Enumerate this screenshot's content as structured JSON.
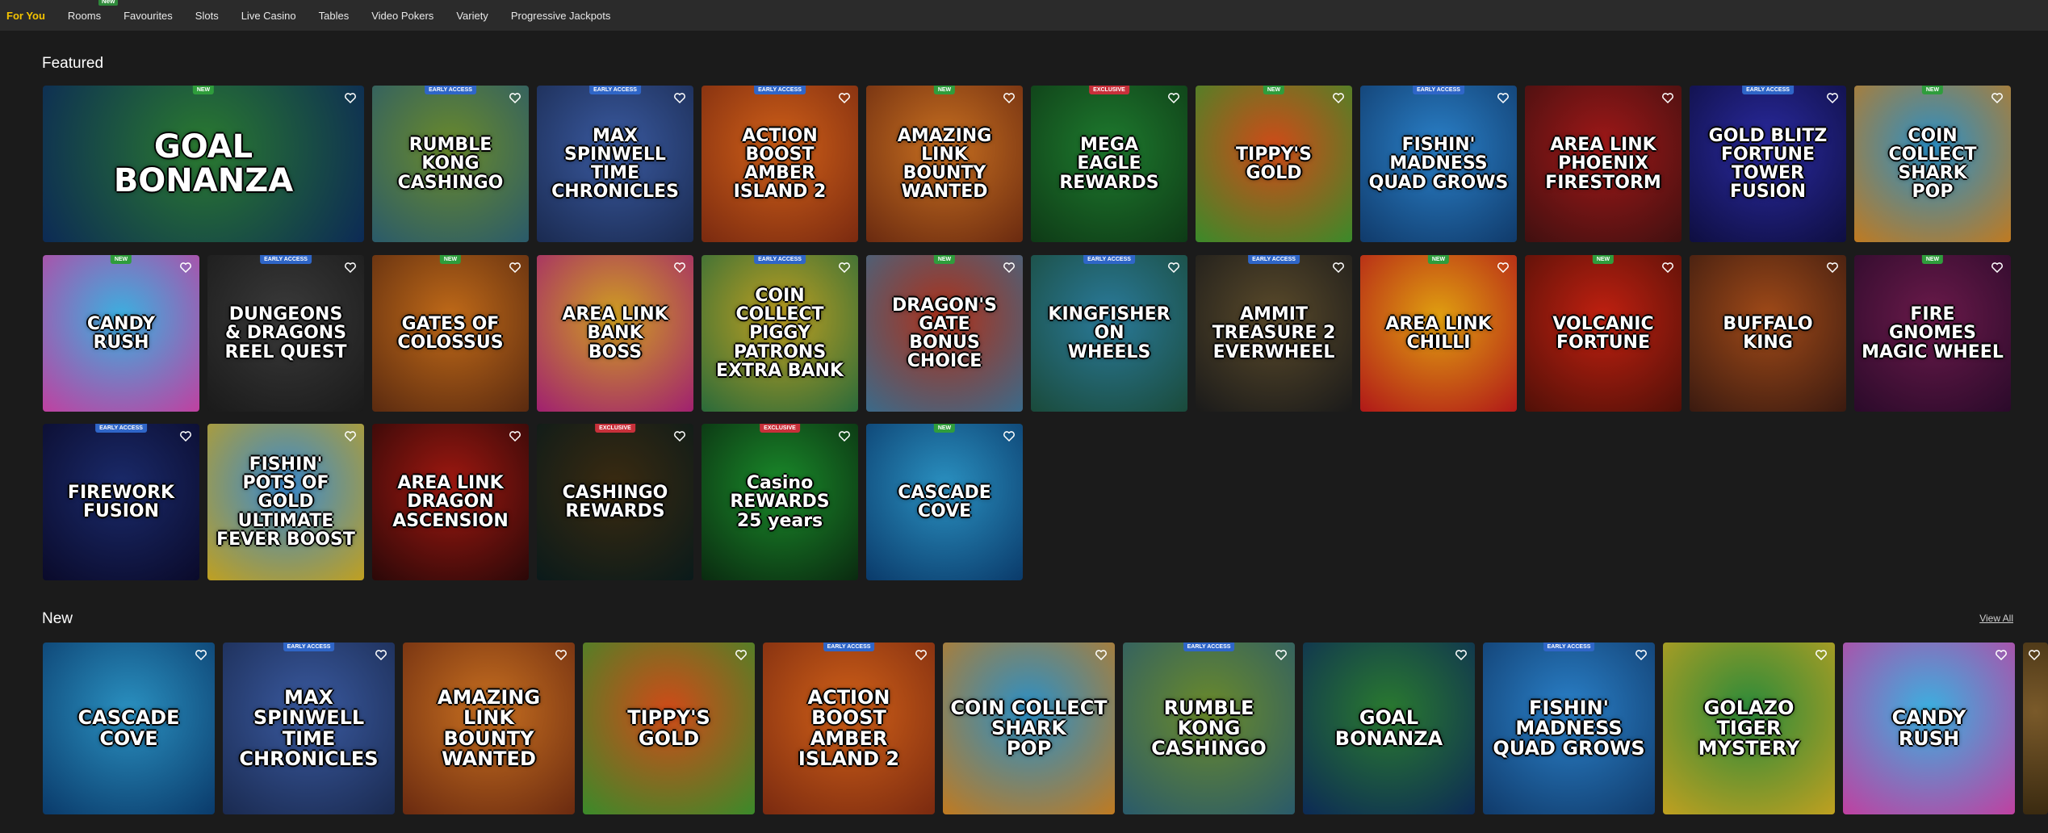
{
  "nav": {
    "items": [
      {
        "label": "For You",
        "active": true
      },
      {
        "label": "Rooms",
        "badge": "New"
      },
      {
        "label": "Favourites"
      },
      {
        "label": "Slots"
      },
      {
        "label": "Live Casino"
      },
      {
        "label": "Tables"
      },
      {
        "label": "Video Pokers"
      },
      {
        "label": "Variety"
      },
      {
        "label": "Progressive Jackpots"
      }
    ]
  },
  "featured": {
    "title": "Featured",
    "games": [
      {
        "title": "GOAL\nBONANZA",
        "badge": "NEW",
        "color": "#2a7a2f",
        "color2": "#0c2a55"
      },
      {
        "title": "RUMBLE\nKONG\nCASHINGO",
        "badge": "EARLY ACCESS",
        "color": "#6a8a2a",
        "color2": "#2a5a6a"
      },
      {
        "title": "MAX\nSPINWELL\nTIME CHRONICLES",
        "badge": "EARLY ACCESS",
        "color": "#3a5aa0",
        "color2": "#1a2a50"
      },
      {
        "title": "ACTION BOOST\nAMBER\nISLAND 2",
        "badge": "EARLY ACCESS",
        "color": "#d06018",
        "color2": "#7a2a10"
      },
      {
        "title": "AMAZING LINK\nBOUNTY\nWANTED",
        "badge": "NEW",
        "color": "#c87020",
        "color2": "#6a2a10"
      },
      {
        "title": "MEGA\nEAGLE\nREWARDS",
        "badge": "EXCLUSIVE",
        "color": "#1e7a2e",
        "color2": "#0e3a16"
      },
      {
        "title": "TIPPY'S\nGOLD",
        "badge": "NEW",
        "color": "#d04a18",
        "color2": "#3a8a2a"
      },
      {
        "title": "FISHIN'\nMADNESS\nQUAD GROWS",
        "badge": "EARLY ACCESS",
        "color": "#2a80c8",
        "color2": "#103a6a"
      },
      {
        "title": "AREA LINK\nPHOENIX\nFIRESTORM",
        "color": "#a01818",
        "color2": "#401010"
      },
      {
        "title": "GOLD BLITZ\nFORTUNE TOWER\nFUSION",
        "badge": "EARLY ACCESS",
        "color": "#2a2aa0",
        "color2": "#0e0e40"
      },
      {
        "title": "COIN COLLECT\nSHARK\nPOP",
        "badge": "NEW",
        "color": "#2a90c8",
        "color2": "#c07a20"
      },
      {
        "title": "CANDY\nRUSH",
        "badge": "NEW",
        "color": "#3ab0e0",
        "color2": "#c040a0"
      },
      {
        "title": "DUNGEONS\n& DRAGONS\nREEL QUEST",
        "badge": "EARLY ACCESS",
        "color": "#3a3a3a",
        "color2": "#1a1a1a"
      },
      {
        "title": "GATES OF\nCOLOSSUS",
        "badge": "NEW",
        "color": "#c06a18",
        "color2": "#5a2a10"
      },
      {
        "title": "AREA LINK\nBANK\nBOSS",
        "color": "#d0a020",
        "color2": "#a02070"
      },
      {
        "title": "COIN COLLECT\nPIGGY\nPATRONS\nEXTRA BANK",
        "badge": "EARLY ACCESS",
        "color": "#c0a020",
        "color2": "#2a6a3a"
      },
      {
        "title": "DRAGON'S GATE\nBONUS CHOICE",
        "badge": "NEW",
        "color": "#b03018",
        "color2": "#3a6a8a"
      },
      {
        "title": "KINGFISHER\nON\nWHEELS",
        "badge": "EARLY ACCESS",
        "color": "#2a7a9a",
        "color2": "#1a4a3a"
      },
      {
        "title": "AMMIT\nTREASURE 2\nEVERWHEEL",
        "badge": "EARLY ACCESS",
        "color": "#5a4a2a",
        "color2": "#1a1a1a"
      },
      {
        "title": "AREA LINK\nCHILLI",
        "badge": "NEW",
        "color": "#e0a010",
        "color2": "#b01818"
      },
      {
        "title": "VOLCANIC\nFORTUNE",
        "badge": "NEW",
        "color": "#c02010",
        "color2": "#501008"
      },
      {
        "title": "BUFFALO\nKING",
        "color": "#a04a18",
        "color2": "#3a1a10"
      },
      {
        "title": "FIRE\nGNOMES\nMAGIC WHEEL",
        "badge": "NEW",
        "color": "#6a1a4a",
        "color2": "#2a0a2a"
      },
      {
        "title": "FIREWORK\nFUSION",
        "badge": "EARLY ACCESS",
        "color": "#1a2a6a",
        "color2": "#0a0a2a"
      },
      {
        "title": "FISHIN'\nPOTS OF GOLD\nULTIMATE\nFEVER BOOST",
        "color": "#3a8ad0",
        "color2": "#c0a020"
      },
      {
        "title": "AREA LINK\nDRAGON\nASCENSION",
        "color": "#a01810",
        "color2": "#2a0808"
      },
      {
        "title": "CASHINGO\nREWARDS",
        "badge": "EXCLUSIVE",
        "color": "#3a2a10",
        "color2": "#0a1a1a"
      },
      {
        "title": "Casino REWARDS\n25 years",
        "badge": "EXCLUSIVE",
        "color": "#1a8a2a",
        "color2": "#0a2a10"
      },
      {
        "title": "CASCADE\nCOVE",
        "badge": "NEW",
        "color": "#2a90c0",
        "color2": "#0a3a6a"
      }
    ]
  },
  "new_section": {
    "title": "New",
    "view_all": "View All",
    "games": [
      {
        "title": "CASCADE\nCOVE",
        "color": "#2a90c0",
        "color2": "#0a3a6a"
      },
      {
        "title": "MAX\nSPINWELL\nTIME CHRONICLES",
        "badge": "EARLY ACCESS",
        "color": "#3a5aa0",
        "color2": "#1a2a50"
      },
      {
        "title": "AMAZING LINK\nBOUNTY\nWANTED",
        "color": "#c87020",
        "color2": "#6a2a10"
      },
      {
        "title": "TIPPY'S\nGOLD",
        "color": "#d04a18",
        "color2": "#3a8a2a"
      },
      {
        "title": "ACTION BOOST\nAMBER\nISLAND 2",
        "badge": "EARLY ACCESS",
        "color": "#d06018",
        "color2": "#7a2a10"
      },
      {
        "title": "COIN COLLECT\nSHARK\nPOP",
        "color": "#2a90c8",
        "color2": "#c07a20"
      },
      {
        "title": "RUMBLE\nKONG\nCASHINGO",
        "badge": "EARLY ACCESS",
        "color": "#6a8a2a",
        "color2": "#2a5a6a"
      },
      {
        "title": "GOAL\nBONANZA",
        "color": "#2a7a2f",
        "color2": "#0c2a55"
      },
      {
        "title": "FISHIN'\nMADNESS\nQUAD GROWS",
        "badge": "EARLY ACCESS",
        "color": "#2a80c8",
        "color2": "#103a6a"
      },
      {
        "title": "GOLAZO\nTIGER\nMYSTERY",
        "color": "#2a8a3a",
        "color2": "#c0a020"
      },
      {
        "title": "CANDY\nRUSH",
        "color": "#3ab0e0",
        "color2": "#c040a0"
      },
      {
        "title": "",
        "color": "#7a5a2a",
        "color2": "#3a2a10"
      }
    ]
  }
}
